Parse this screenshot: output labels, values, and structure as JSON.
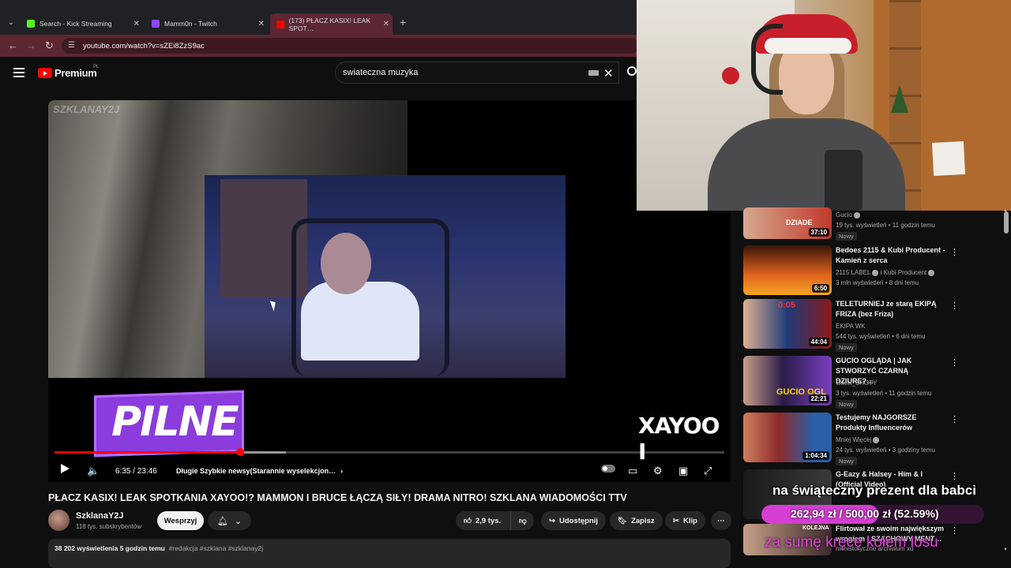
{
  "browser": {
    "tabs": [
      {
        "title": "Search - Kick Streaming",
        "favicon_color": "#53fc18"
      },
      {
        "title": "Mamm0n - Twitch",
        "favicon_color": "#9146ff"
      },
      {
        "title": "(173) PŁACZ KASIX! LEAK SPOT…",
        "favicon_color": "#ff0000"
      }
    ],
    "new_tab": "+",
    "url": "youtube.com/watch?v=sZEi8ZzS9ac"
  },
  "header": {
    "brand": "Premium",
    "region": "PL",
    "search_query": "swiateczna muzyka"
  },
  "player": {
    "watermark": "SZKLANAY2J",
    "overlay_badge": "PILNE",
    "overlay_caption": "XAYOO I",
    "time": "6:35 / 23:46",
    "chapter": "Długie Szybkie newsy(Starannie wyselekcjon…",
    "progress_played": 0.277,
    "progress_buffered": 0.345
  },
  "video": {
    "title": "PŁACZ KASIX! LEAK SPOTKANIA XAYOO!? MAMMON I BRUCE ŁĄCZĄ SIŁY! DRAMA NITRO! SZKLANA WIADOMOŚCI TTV",
    "channel": "SzklanaY2J",
    "subscribers": "118 tys. subskrybentów",
    "support_label": "Wesprzyj",
    "likes": "2,9 tys.",
    "share_label": "Udostępnij",
    "save_label": "Zapisz",
    "clip_label": "Klip",
    "views": "38 202 wyświetlenia  5 godzin temu",
    "tags": "#redakcja #szklana #szklanay2j"
  },
  "recommendations": [
    {
      "title": "",
      "channel": "Gucio",
      "meta": "19 tys. wyświetleń • 11 godzin temu",
      "badge": "Nowy",
      "duration": "37:10",
      "thumb_text": "DZIADE",
      "thumb_color": "#c0392b"
    },
    {
      "title": "Bedoes 2115 & Kubi Producent - Kamień z serca",
      "channel": "2115 LABEL",
      "channel2": "i Kubi Producent",
      "meta": "3 mln wyświetleń • 8 dni temu",
      "badge": "",
      "duration": "6:50",
      "thumb_text": "",
      "thumb_color": "#d35400"
    },
    {
      "title": "TELETURNIEJ ze starą EKIPĄ FRIZA (bez Friza)",
      "channel": "EKIPA WK",
      "meta": "544 tys. wyświetleń • 6 dni temu",
      "badge": "Nowy",
      "duration": "44:04",
      "thumb_text": "0:05",
      "thumb_color": "#1f3a78"
    },
    {
      "title": "GUCIO OGLĄDA | JAK STWORZYĆ CZARNĄ DZIURE?…",
      "channel": "Gucci_SHOTY",
      "meta": "3 tys. wyświetleń • 11 godzin temu",
      "badge": "Nowy",
      "duration": "22:21",
      "thumb_text": "GUCIO OGL",
      "thumb_color": "#5b2d7a"
    },
    {
      "title": "Testujemy NAJGORSZE Produkty Influencerów",
      "channel": "Mniej Więcej",
      "meta": "24 tys. wyświetleń • 3 godziny temu",
      "badge": "Nowy",
      "duration": "1:04:34",
      "thumb_text": "",
      "thumb_color": "#8e2b2b"
    },
    {
      "title": "G-Eazy & Halsey - Him & I (Official Video)",
      "channel": "",
      "meta": "",
      "badge": "",
      "duration": "",
      "thumb_text": "",
      "thumb_color": "#2a2a2a"
    },
    {
      "title": "Flirtował ze swoim największym wrogiem - SZACHOWY MENT…",
      "channel": "niehistoryczne archiwum xd",
      "meta": "",
      "badge": "",
      "duration": "",
      "thumb_text": "KOLEJNA",
      "thumb_color": "#3a2a2a"
    }
  ],
  "donation_goal": {
    "title": "na świąteczny prezent dla babci",
    "amount": "262,94 zł / 500,00 zł (52.59%)",
    "fraction": 0.5259,
    "subtitle": "za sumę kręcę kołem losu"
  }
}
